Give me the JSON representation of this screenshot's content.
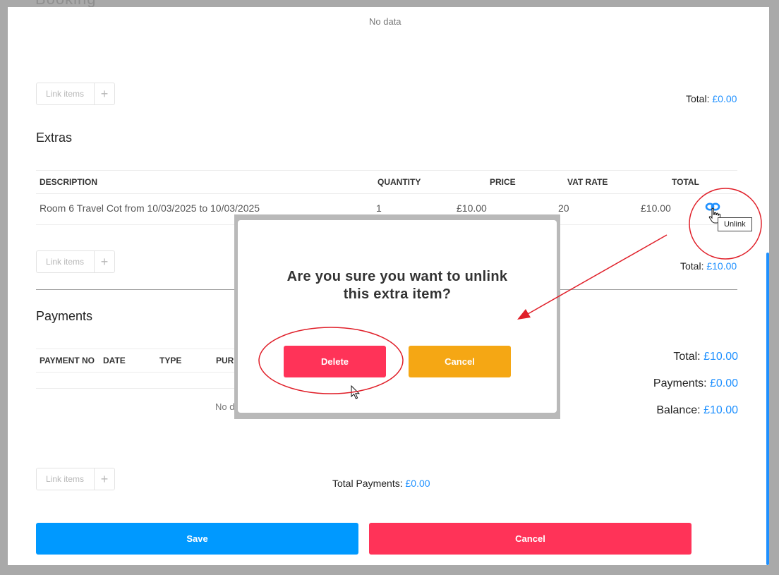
{
  "background_title": "Booking",
  "top_no_data": "No data",
  "link_items_label": "Link items",
  "link_items_plus": "+",
  "items_total": {
    "label": "Total: ",
    "value": "£0.00"
  },
  "extras": {
    "title": "Extras",
    "columns": [
      "DESCRIPTION",
      "QUANTITY",
      "PRICE",
      "VAT RATE",
      "TOTAL"
    ],
    "rows": [
      {
        "description": "Room 6 Travel Cot from 10/03/2025 to 10/03/2025",
        "quantity": "1",
        "price": "£10.00",
        "vat_rate": "20",
        "total": "£10.00"
      }
    ],
    "total": {
      "label": "Total: ",
      "value": "£10.00"
    }
  },
  "tooltip": "Unlink",
  "payments": {
    "title": "Payments",
    "columns": [
      "PAYMENT NO",
      "DATE",
      "TYPE",
      "PURP"
    ],
    "no_data": "No d",
    "summary": [
      {
        "label": "Total: ",
        "value": "£10.00"
      },
      {
        "label": "Payments: ",
        "value": "£0.00"
      },
      {
        "label": "Balance: ",
        "value": "£10.00"
      }
    ],
    "total_payments": {
      "label": "Total Payments: ",
      "value": "£0.00"
    }
  },
  "footer": {
    "save_label": "Save",
    "cancel_label": "Cancel"
  },
  "modal": {
    "question_line1": "Are you sure you want to unlink",
    "question_line2": "this extra item?",
    "delete_label": "Delete",
    "cancel_label": "Cancel"
  },
  "colors": {
    "primary_blue": "#0099ff",
    "danger_red": "#ff3358",
    "warning_orange": "#f5a714",
    "link_blue": "#1e90ff",
    "annotation_red": "#e0202a"
  },
  "icons": [
    "unlink-icon",
    "hand-cursor-icon",
    "arrow-cursor-icon",
    "plus-icon"
  ]
}
